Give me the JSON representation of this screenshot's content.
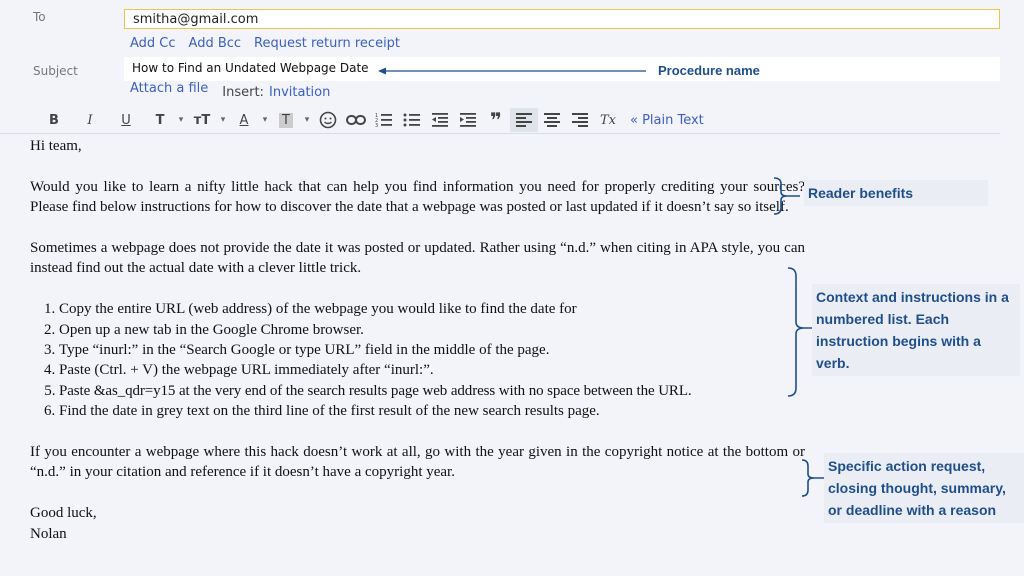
{
  "header": {
    "to_label": "To",
    "to_value": "smitha@gmail.com",
    "add_cc": "Add Cc",
    "add_bcc": "Add Bcc",
    "request_receipt": "Request return receipt",
    "subject_label": "Subject",
    "subject_value": "How to Find an Undated Webpage Date",
    "attach_file": "Attach a file",
    "insert_label": "Insert:",
    "insert_invitation": "Invitation"
  },
  "toolbar": {
    "bold": "B",
    "italic": "I",
    "underline": "U",
    "font": "T",
    "font_size": "тT",
    "text_color": "A",
    "highlight": "T",
    "remove_format": "Tx",
    "plain_text": "« Plain Text"
  },
  "body": {
    "greeting": "Hi team,",
    "para1": "Would you like to learn a nifty little hack that can help you find information you need for properly crediting your sources? Please find below instructions for how to discover the date that a webpage was posted or last updated if it doesn’t say so itself.",
    "para2": "Sometimes a webpage does not provide the date it was posted or updated. Rather using “n.d.” when citing in APA style, you can instead find out the actual date with a clever little trick.",
    "steps": [
      "Copy the entire URL (web address) of the webpage you would like to find the date for",
      "Open up a new tab in the Google Chrome browser.",
      "Type “inurl:” in the “Search Google or type URL” field in the middle of the page.",
      "Paste (Ctrl. + V) the webpage URL immediately after “inurl:”.",
      "Paste &as_qdr=y15 at the very end of the search results page web address with no space between the URL.",
      "Find the date in grey text on the third line of the first result of the new search results page."
    ],
    "para3": "If you encounter a webpage where this hack doesn’t work at all, go with the year given in the copyright notice at the bottom or “n.d.” in your citation and reference if it doesn’t have a copyright year.",
    "closing": "Good luck,",
    "signature": "Nolan"
  },
  "annotations": {
    "procedure_name": "Procedure name",
    "reader_benefits": "Reader benefits",
    "context": "Context and instructions in a numbered list. Each instruction begins with a verb.",
    "action": "Specific action request, closing thought, summary, or deadline with a reason"
  },
  "colors": {
    "annotation": "#1f4e8c",
    "link": "#3b5fc4",
    "field_border": "#e6c94a"
  }
}
